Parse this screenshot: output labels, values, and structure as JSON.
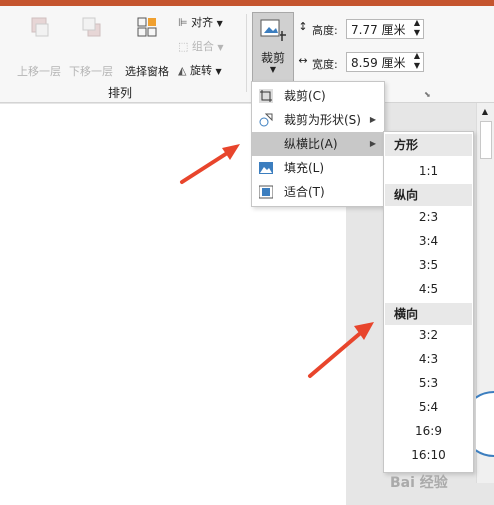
{
  "ribbon": {
    "move_up_label": "上移一层",
    "move_down_label": "下移一层",
    "selection_pane_label": "选择窗格",
    "align_label": "对齐",
    "group_label": "组合",
    "rotate_label": "旋转",
    "arrange_group_label": "排列",
    "crop_label": "裁剪",
    "height_label": "高度:",
    "height_value": "7.77 厘米",
    "width_label": "宽度:",
    "width_value": "8.59 厘米"
  },
  "crop_menu": {
    "items": [
      {
        "label": "裁剪(C)"
      },
      {
        "label": "裁剪为形状(S)"
      },
      {
        "label": "纵横比(A)"
      },
      {
        "label": "填充(L)"
      },
      {
        "label": "适合(T)"
      }
    ]
  },
  "aspect_menu": {
    "square_header": "方形",
    "square_options": [
      "1:1"
    ],
    "portrait_header": "纵向",
    "portrait_options": [
      "2:3",
      "3:4",
      "3:5",
      "4:5"
    ],
    "landscape_header": "横向",
    "landscape_options": [
      "3:2",
      "4:3",
      "5:3",
      "5:4",
      "16:9",
      "16:10"
    ]
  },
  "watermark": "Bai 经验"
}
